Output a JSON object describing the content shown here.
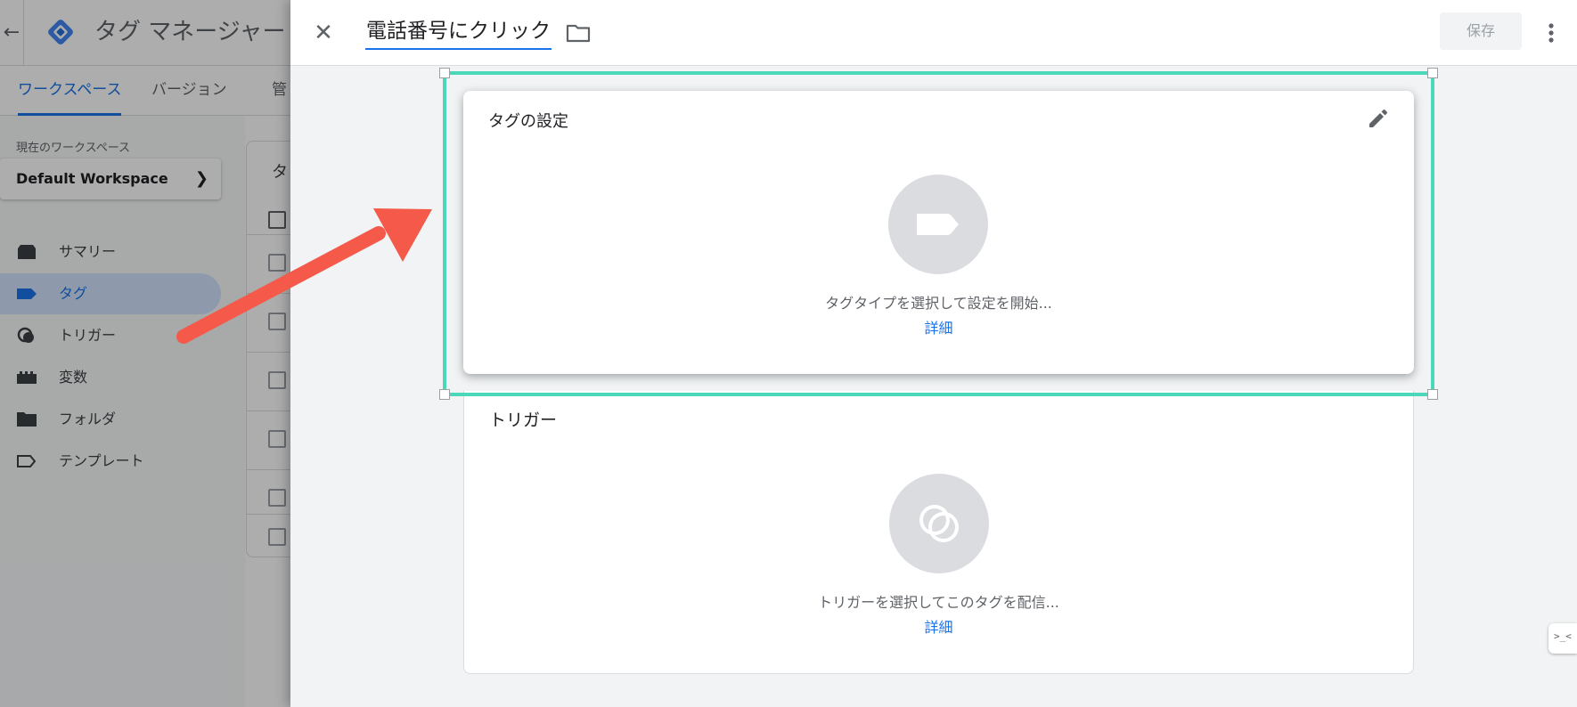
{
  "background_app": {
    "title": "タグ マネージャー",
    "tabs": [
      {
        "label": "ワークスペース",
        "active": true
      },
      {
        "label": "バージョン",
        "active": false
      },
      {
        "label": "管",
        "active": false
      }
    ],
    "workspace_label": "現在のワークスペース",
    "workspace_name": "Default Workspace",
    "nav": [
      {
        "label": "サマリー",
        "icon": "summary-icon",
        "active": false
      },
      {
        "label": "タグ",
        "icon": "tag-icon",
        "active": true
      },
      {
        "label": "トリガー",
        "icon": "trigger-icon",
        "active": false
      },
      {
        "label": "変数",
        "icon": "variables-icon",
        "active": false
      },
      {
        "label": "フォルダ",
        "icon": "folder-icon",
        "active": false
      },
      {
        "label": "テンプレート",
        "icon": "template-icon",
        "active": false
      }
    ],
    "table_header_partial": "タ"
  },
  "sheet": {
    "tag_name": "電話番号にクリック",
    "save_label": "保存",
    "tag_config": {
      "title": "タグの設定",
      "hint": "タグタイプを選択して設定を開始...",
      "details": "詳細"
    },
    "trigger_config": {
      "title": "トリガー",
      "hint": "トリガーを選択してこのタグを配信...",
      "details": "詳細"
    }
  },
  "colors": {
    "accent": "#1a73e8",
    "highlight": "#4ad8b8",
    "arrow": "#f4594a"
  }
}
